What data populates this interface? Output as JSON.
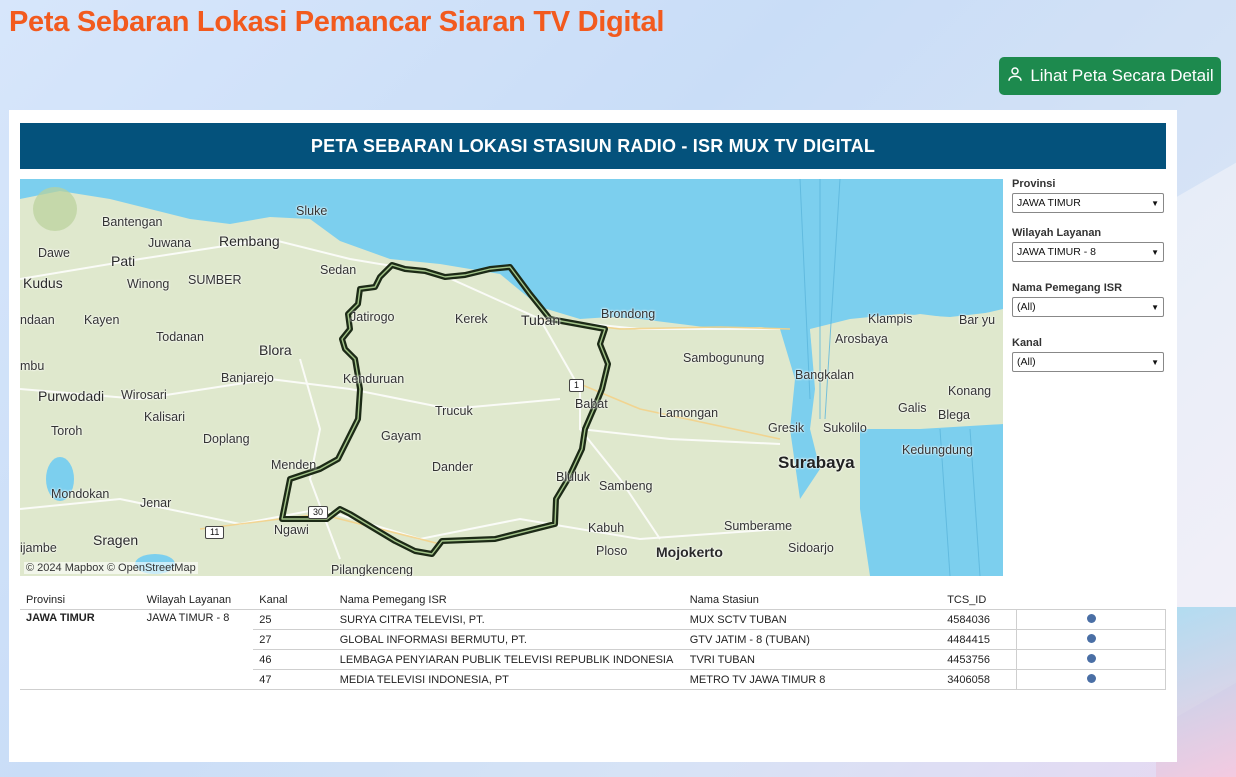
{
  "page_title": "Peta Sebaran Lokasi Pemancar Siaran TV Digital",
  "detail_button": {
    "label": "Lihat Peta Secara Detail",
    "icon": "person-pin-icon"
  },
  "banner_title": "PETA SEBARAN LOKASI STASIUN RADIO - ISR MUX TV DIGITAL",
  "map": {
    "attribution": "© 2024 Mapbox © OpenStreetMap",
    "colors": {
      "sea": "#7ccfee",
      "land": "#dfe8cd",
      "boundary": "#1c2a16"
    },
    "places": {
      "bantengan": "Bantengan",
      "juwana": "Juwana",
      "rembang": "Rembang",
      "sluke": "Sluke",
      "dawe": "Dawe",
      "pati": "Pati",
      "sedan": "Sedan",
      "kudus": "Kudus",
      "winong": "Winong",
      "sumber": "SUMBER",
      "undaan": "ndaan",
      "kayen": "Kayen",
      "jatirogo": "Jatirogo",
      "kerek": "Kerek",
      "tuban": "Tuban",
      "brondong": "Brondong",
      "klampis": "Klampis",
      "bangkalan_bay": "Bar yu",
      "todanan": "Todanan",
      "blora": "Blora",
      "sambogunung": "Sambogunung",
      "arosbaya": "Arosbaya",
      "mbu": "mbu",
      "banjarejo": "Banjarejo",
      "kenduruan": "Kenduruan",
      "bangkalan": "Bangkalan",
      "purwodadi": "Purwodadi",
      "wirosari": "Wirosari",
      "babat": "Babat",
      "konang": "Konang",
      "kalisari": "Kalisari",
      "trucuk": "Trucuk",
      "lamongan": "Lamongan",
      "galis": "Galis",
      "blega": "Blega",
      "toroh": "Toroh",
      "doplang": "Doplang",
      "gayam": "Gayam",
      "gresik": "Gresik",
      "sukolilo": "Sukolilo",
      "kedungdung": "Kedungdung",
      "surabaya": "Surabaya",
      "menden": "Menden",
      "dander": "Dander",
      "bluluk": "Bluluk",
      "mondokan": "Mondokan",
      "sambeng": "Sambeng",
      "jenar": "Jenar",
      "ngawi": "Ngawi",
      "kabuh": "Kabuh",
      "sumberame": "Sumberame",
      "sragen": "Sragen",
      "ploso": "Ploso",
      "mojokerto": "Mojokerto",
      "sidoarjo": "Sidoarjo",
      "ijambe": "ijambe",
      "pilangkenceng": "Pilangkenceng"
    },
    "road_shields": {
      "r1": "1",
      "r30": "30",
      "r11": "11"
    }
  },
  "filters": [
    {
      "label": "Provinsi",
      "value": "JAWA TIMUR"
    },
    {
      "label": "Wilayah Layanan",
      "value": "JAWA TIMUR - 8"
    },
    {
      "label": "Nama Pemegang ISR",
      "value": "(All)"
    },
    {
      "label": "Kanal",
      "value": "(All)"
    }
  ],
  "table": {
    "columns": [
      "Provinsi",
      "Wilayah Layanan",
      "Kanal",
      "Nama Pemegang ISR",
      "Nama Stasiun",
      "TCS_ID"
    ],
    "provinsi": "JAWA TIMUR",
    "wilayah": "JAWA TIMUR - 8",
    "rows": [
      {
        "kanal": "25",
        "pemegang": "SURYA CITRA TELEVISI, PT.",
        "stasiun": "MUX SCTV TUBAN",
        "tcs_id": "4584036"
      },
      {
        "kanal": "27",
        "pemegang": "GLOBAL INFORMASI  BERMUTU, PT.",
        "stasiun": "GTV JATIM - 8 (TUBAN)",
        "tcs_id": "4484415"
      },
      {
        "kanal": "46",
        "pemegang": "LEMBAGA PENYIARAN PUBLIK TELEVISI REPUBLIK INDONESIA",
        "stasiun": "TVRI TUBAN",
        "tcs_id": "4453756"
      },
      {
        "kanal": "47",
        "pemegang": "MEDIA TELEVISI INDONESIA, PT",
        "stasiun": "METRO TV JAWA TIMUR 8",
        "tcs_id": "3406058"
      }
    ]
  }
}
